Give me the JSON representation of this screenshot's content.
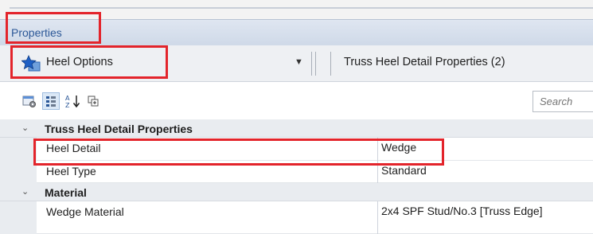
{
  "panel": {
    "title": "Properties"
  },
  "selector": {
    "label": "Heel Options",
    "icon": "star-icon",
    "dropdown_icon": "dropdown-arrow-icon",
    "selection": "Truss Heel Detail Properties (2)"
  },
  "toolbar": {
    "buttons": [
      "property-pages-icon",
      "categorized-icon",
      "sort-alphabetical-icon",
      "expand-icon"
    ],
    "search_placeholder": "Search"
  },
  "grid": {
    "categories": [
      {
        "label": "Truss Heel Detail Properties",
        "properties": [
          {
            "name": "Heel Detail",
            "value": "Wedge"
          },
          {
            "name": "Heel Type",
            "value": "Standard"
          }
        ]
      },
      {
        "label": "Material",
        "properties": [
          {
            "name": "Wedge Material",
            "value": "2x4 SPF Stud/No.3 [Truss Edge]"
          }
        ]
      }
    ]
  },
  "colors": {
    "highlight": "#e3242b",
    "accent": "#2b5797",
    "star": "#1e5fc4"
  }
}
